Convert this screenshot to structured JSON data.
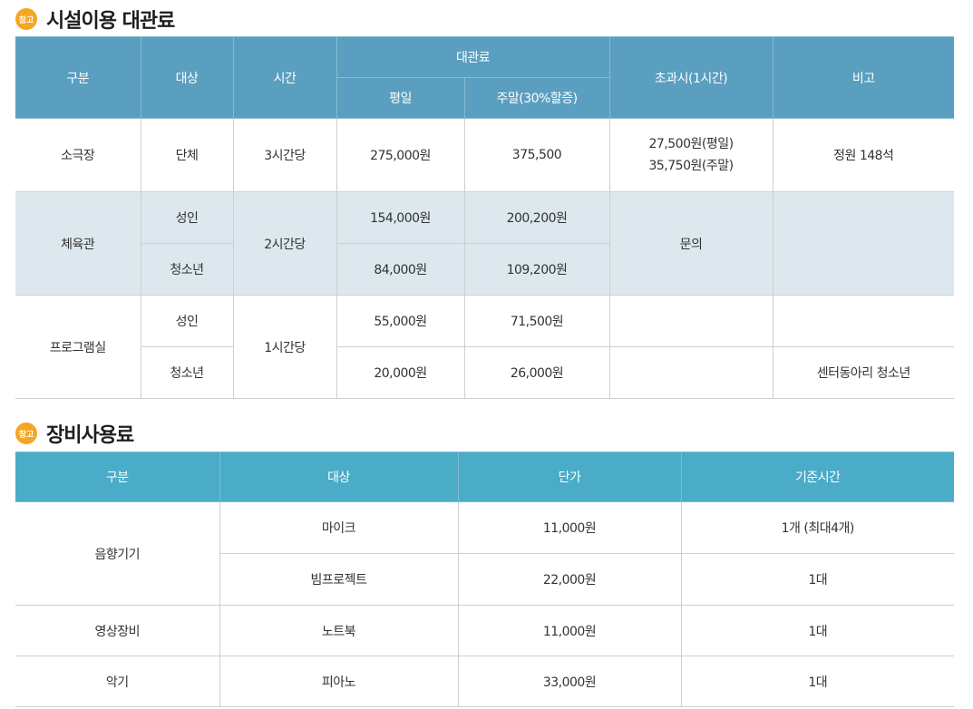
{
  "facility": {
    "badge": "참고",
    "title": "시설이용 대관료",
    "headers": {
      "category": "구분",
      "target": "대상",
      "time": "시간",
      "fee": "대관료",
      "weekday": "평일",
      "weekend": "주말(30%할증)",
      "overtime": "초과시(1시간)",
      "note": "비고"
    },
    "theater": {
      "category": "소극장",
      "target": "단체",
      "time": "3시간당",
      "weekday": "275,000원",
      "weekend": "375,500",
      "overtime_weekday": "27,500원(평일)",
      "overtime_weekend": "35,750원(주말)",
      "note": "정원 148석"
    },
    "gym": {
      "category": "체육관",
      "time": "2시간당",
      "overtime": "문의",
      "adult": {
        "target": "성인",
        "weekday": "154,000원",
        "weekend": "200,200원"
      },
      "youth": {
        "target": "청소년",
        "weekday": "84,000원",
        "weekend": "109,200원"
      }
    },
    "program_room": {
      "category": "프로그램실",
      "time": "1시간당",
      "adult": {
        "target": "성인",
        "weekday": "55,000원",
        "weekend": "71,500원"
      },
      "youth": {
        "target": "청소년",
        "weekday": "20,000원",
        "weekend": "26,000원",
        "note": "센터동아리 청소년"
      }
    }
  },
  "equipment": {
    "badge": "참고",
    "title": "장비사용료",
    "headers": {
      "category": "구분",
      "target": "대상",
      "price": "단가",
      "basis": "기준시간"
    },
    "rows": [
      {
        "category": "음향기기",
        "target": "마이크",
        "price": "11,000원",
        "basis": "1개 (최대4개)"
      },
      {
        "target": "빔프로젝트",
        "price": "22,000원",
        "basis": "1대"
      },
      {
        "category": "영상장비",
        "target": "노트북",
        "price": "11,000원",
        "basis": "1대"
      },
      {
        "category": "악기",
        "target": "피아노",
        "price": "33,000원",
        "basis": "1대"
      }
    ]
  },
  "colors": {
    "header_dark": "#5a9fbf",
    "header_light": "#4aacc7",
    "row_shade": "#dce8ee",
    "badge": "#f5a623"
  }
}
